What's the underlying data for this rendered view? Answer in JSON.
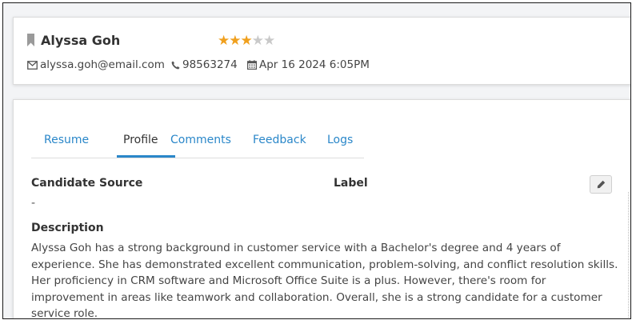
{
  "candidate": {
    "name": "Alyssa Goh",
    "rating": 3,
    "rating_max": 5,
    "email": "alyssa.goh@email.com",
    "phone": "98563274",
    "date": "Apr 16 2024 6:05PM"
  },
  "tabs": [
    {
      "label": "Resume",
      "active": false
    },
    {
      "label": "Profile",
      "active": true
    },
    {
      "label": "Comments",
      "active": false
    },
    {
      "label": "Feedback",
      "active": false
    },
    {
      "label": "Logs",
      "active": false
    }
  ],
  "profile": {
    "source_label": "Candidate Source",
    "label_label": "Label",
    "source_value": "-",
    "description_label": "Description",
    "description": "Alyssa Goh has a strong background in customer service with a Bachelor's degree and 4 years of experience. She has demonstrated excellent communication, problem-solving, and conflict resolution skills. Her proficiency in CRM software and Microsoft Office Suite is a plus. However, there's room for improvement in areas like teamwork and collaboration. Overall, she is a strong candidate for a customer service role."
  },
  "icons": {
    "bookmark": "bookmark-icon",
    "star": "star-icon",
    "email": "envelope-icon",
    "phone": "phone-icon",
    "date": "calendar-icon",
    "edit": "pencil-icon"
  },
  "colors": {
    "link": "#2a87c9",
    "star_on": "#f0a01e",
    "star_off": "#c9c9c9"
  }
}
